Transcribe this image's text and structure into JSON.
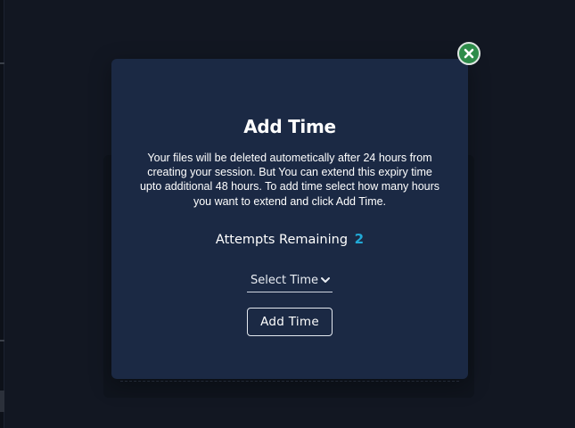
{
  "modal": {
    "title": "Add Time",
    "description": "Your files will be deleted autometically after 24 hours from creating your session. But You can extend this expiry time upto additional 48 hours. To add time select how many hours you want to extend and click Add Time.",
    "attempts_label": "Attempts Remaining",
    "attempts_count": "2",
    "select": {
      "selected": "Select Time"
    },
    "add_button_label": "Add Time",
    "close_icon": "close-icon"
  },
  "colors": {
    "page_background": "#121722",
    "modal_background": "#1b2944",
    "accent_count": "#21a9d6",
    "close_button": "#2e8c4a",
    "text": "#ffffff"
  }
}
